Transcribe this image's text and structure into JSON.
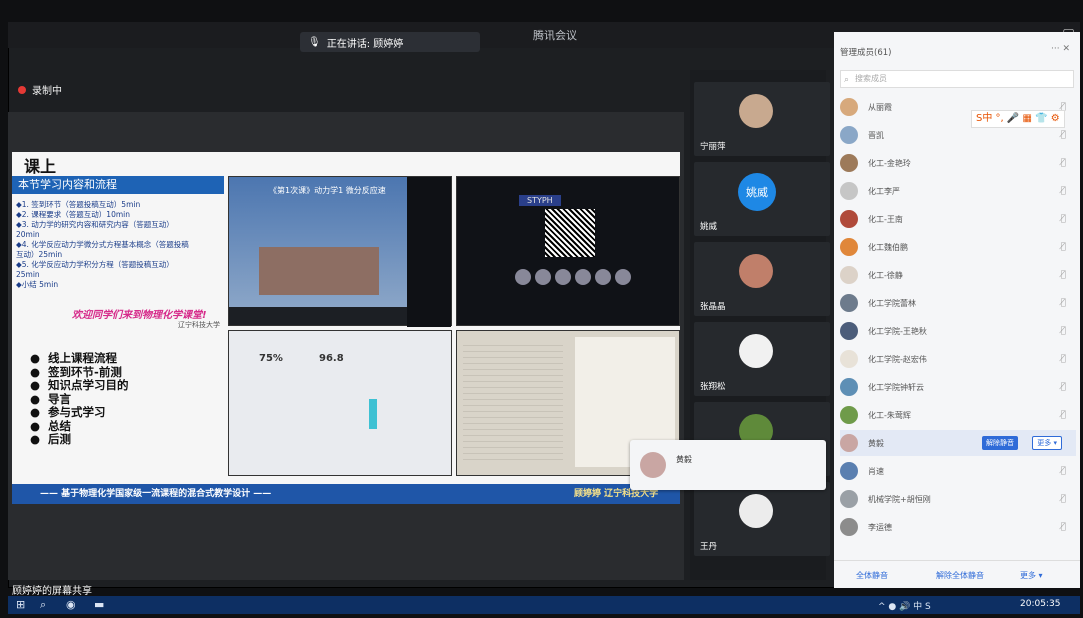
{
  "window": {
    "title": "腾讯会议",
    "speaking": "正在讲话: 顾婷婷",
    "controls": [
      "—",
      "▢"
    ]
  },
  "recording": {
    "label": "录制中",
    "color": "#e53935"
  },
  "slide": {
    "title": "课上",
    "band": "本节学习内容和流程",
    "agenda": [
      "◆1. 签到环节（答题投稿互动）5min",
      "◆2. 课程要求（答题互动）10min",
      "◆3. 动力学的研究内容和研究内容（答题互动）",
      "20min",
      "◆4. 化学反应动力学微分式方程基本概念（答题投稿",
      "互动）25min",
      "◆5. 化学反应动力学积分方程（答题投稿互动）",
      "25min",
      "◆小结 5min"
    ],
    "welcome": "欢迎同学们来到物理化学课堂!",
    "small_caption": "辽宁科技大学",
    "bullets": [
      "线上课程流程",
      "签到环节-前测",
      "知识点学习目的",
      "导言",
      "参与式学习",
      "总结",
      "后测"
    ],
    "footer_left": "—— 基于物理化学国家级一流课程的混合式教学设计 ——",
    "footer_right": "顾婷婷 辽宁科技大学",
    "thumb1_caption": "《第1次课》动力学1 微分反应速",
    "thumb2_caption": "STYPH",
    "thumb3_stats": [
      "75%",
      "96.8"
    ]
  },
  "videos": [
    {
      "name": "宁丽萍"
    },
    {
      "name": "姚威",
      "avatar_text": "姚威"
    },
    {
      "name": "张晶晶"
    },
    {
      "name": "张翔松"
    },
    {
      "name": ""
    },
    {
      "name": "王丹"
    }
  ],
  "popup": {
    "name": "黄毅"
  },
  "panel": {
    "title": "管理成员(61)",
    "header_actions": "··· ✕",
    "search_placeholder": "搜索成员",
    "ime": "S中 °, 🎤 ▦ 👕 ⚙",
    "members": [
      {
        "name": "从丽霞"
      },
      {
        "name": "晋凯"
      },
      {
        "name": "化工-金艳玲"
      },
      {
        "name": "化工李严"
      },
      {
        "name": "化工-王南"
      },
      {
        "name": "化工魏伯鹏"
      },
      {
        "name": "化工-徐静"
      },
      {
        "name": "化工学院蕾林"
      },
      {
        "name": "化工学院-王艳秋"
      },
      {
        "name": "化工学院-赵宏伟"
      },
      {
        "name": "化工学院钟轩云"
      },
      {
        "name": "化工-朱莺辉"
      },
      {
        "name": "黄毅"
      },
      {
        "name": "肖速"
      },
      {
        "name": "机械学院+胡恒刚"
      },
      {
        "name": "李运德"
      }
    ],
    "selected_actions": {
      "mute": "解除静音",
      "more": "更多 ▾"
    },
    "footer": {
      "mute_all": "全体静音",
      "unmute_all": "解除全体静音",
      "more": "更多 ▾"
    }
  },
  "share_label": "顾婷婷的屏幕共享",
  "taskbar": {
    "time": "20:05:35",
    "tray": "^ ● 🔊 中 S"
  }
}
